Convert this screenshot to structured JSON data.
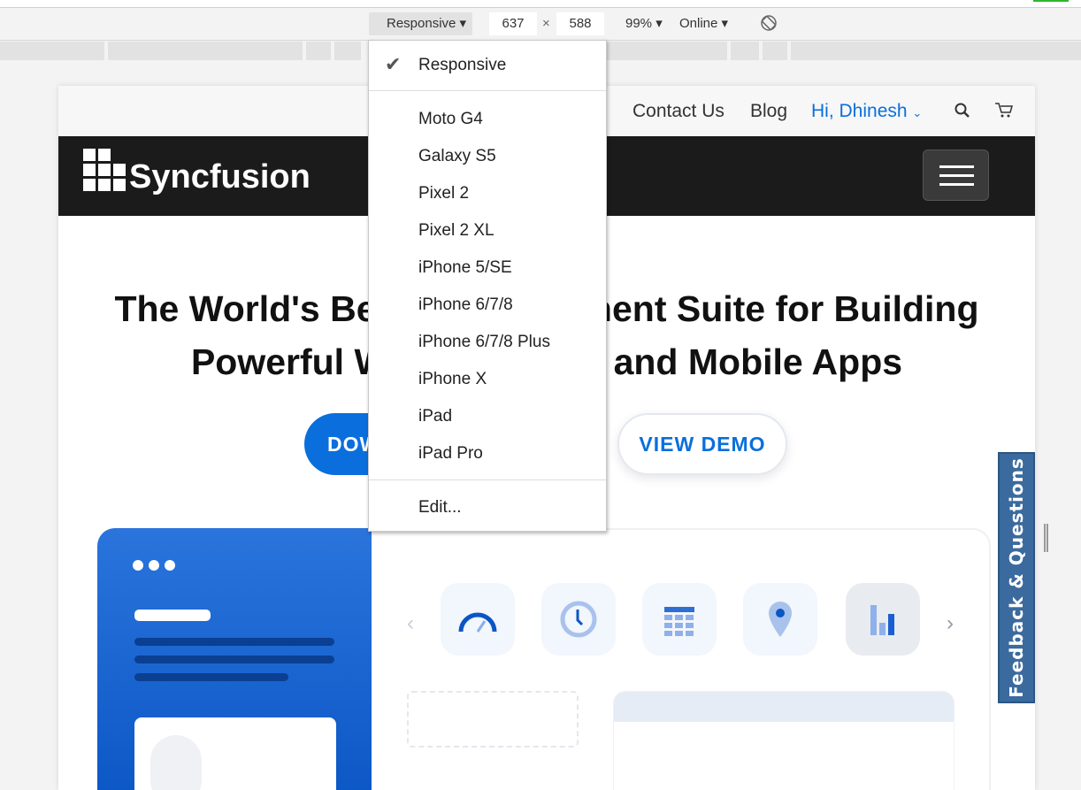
{
  "toolbar": {
    "device": "Responsive",
    "width": "637",
    "height": "588",
    "times": "×",
    "zoom": "99%",
    "network": "Online",
    "rotate_icon": "rotate-icon"
  },
  "menu": {
    "selected": "Responsive",
    "devices": [
      "Moto G4",
      "Galaxy S5",
      "Pixel 2",
      "Pixel 2 XL",
      "iPhone 5/SE",
      "iPhone 6/7/8",
      "iPhone 6/7/8 Plus",
      "iPhone X",
      "iPad",
      "iPad Pro"
    ],
    "edit": "Edit..."
  },
  "site": {
    "nav": {
      "contact": "Contact Us",
      "blog": "Blog",
      "user": "Hi, Dhinesh"
    },
    "logo": "Syncfusion",
    "title_line1": "The World's Best UI Component Suite for Building",
    "title_line2": "Powerful Web, Desktop, and Mobile Apps",
    "download": "DOWNLOAD FREE TRIAL",
    "demo": "VIEW DEMO",
    "feedback": "Feedback & Questions"
  },
  "colors": {
    "accent": "#0a6fdc",
    "band": "#1b1b1b",
    "feedback": "#3b6a9e"
  }
}
